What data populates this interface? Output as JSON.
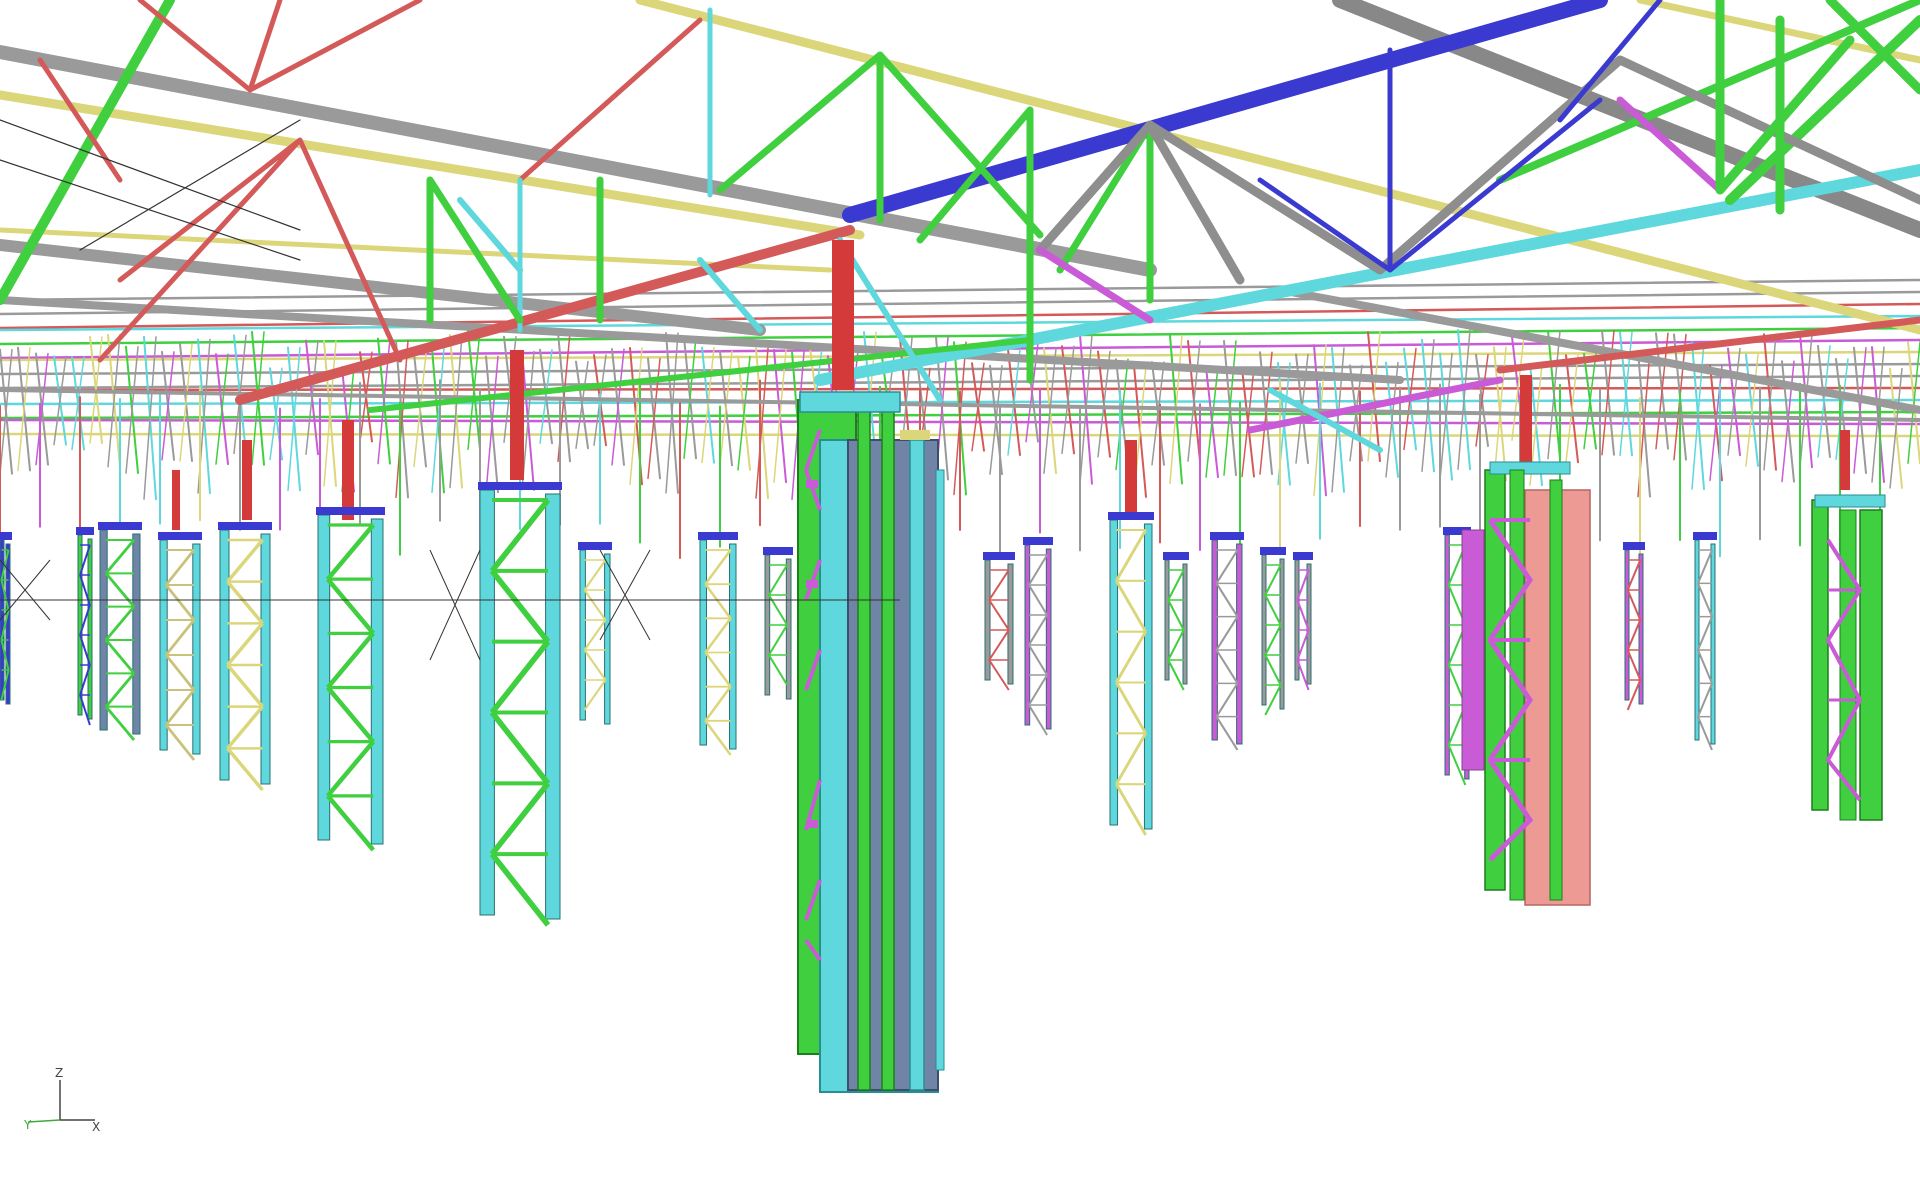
{
  "viewport": {
    "background": "#ffffff",
    "palette": {
      "truss_gray": "#9a9a9a",
      "truss_red": "#d45a5a",
      "truss_green": "#3fcf3f",
      "truss_cyan": "#5ed8dc",
      "truss_blue": "#3a3ad0",
      "truss_yellow": "#dcd67a",
      "truss_magenta": "#c95bd6",
      "column_red": "#d43a3a",
      "column_slate": "#6f84a6",
      "column_pink": "#ee9a94"
    }
  },
  "axis_triad": {
    "z_label": "Z",
    "y_label": "Y",
    "x_label": "X",
    "z_color": "#444444",
    "y_color": "#3fa83f",
    "x_color": "#444444"
  }
}
